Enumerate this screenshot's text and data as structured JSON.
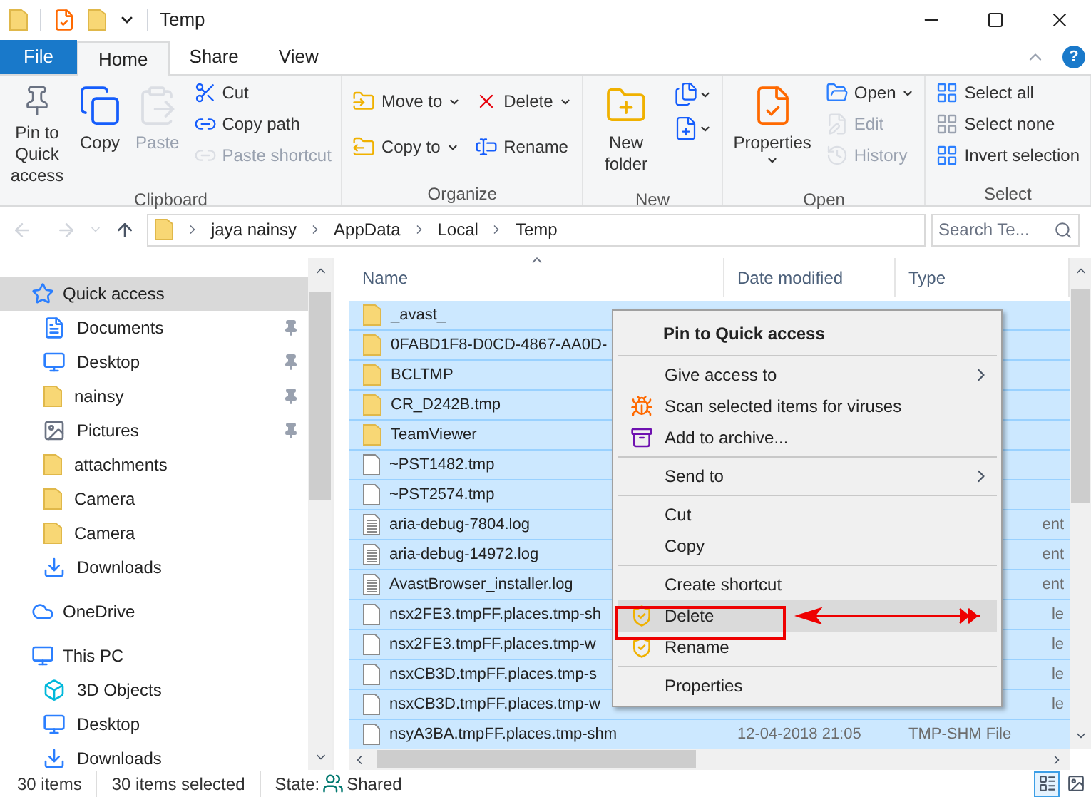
{
  "window": {
    "title": "Temp",
    "help": "?"
  },
  "ribbon_tabs": [
    {
      "label": "File",
      "kind": "file",
      "selected": false
    },
    {
      "label": "Home",
      "kind": "tab",
      "selected": true
    },
    {
      "label": "Share",
      "kind": "tab",
      "selected": false
    },
    {
      "label": "View",
      "kind": "tab",
      "selected": false
    }
  ],
  "ribbon_groups": [
    {
      "label": "Clipboard",
      "columns": [
        [
          {
            "label": "Pin to Quick access",
            "kind": "large",
            "disabled": false,
            "dropdown": false
          }
        ],
        [
          {
            "label": "Copy",
            "kind": "large",
            "disabled": false,
            "dropdown": false
          }
        ],
        [
          {
            "label": "Paste",
            "kind": "large",
            "disabled": true,
            "dropdown": false
          }
        ],
        [
          {
            "label": "Cut",
            "kind": "small",
            "disabled": false,
            "dropdown": false
          },
          {
            "label": "Copy path",
            "kind": "small",
            "disabled": false,
            "dropdown": false
          },
          {
            "label": "Paste shortcut",
            "kind": "small",
            "disabled": true,
            "dropdown": false
          }
        ]
      ]
    },
    {
      "label": "Organize",
      "columns": [
        [
          {
            "label": "Move to",
            "kind": "small",
            "disabled": false,
            "dropdown": true
          },
          {
            "label": "Copy to",
            "kind": "small",
            "disabled": false,
            "dropdown": true
          }
        ],
        [
          {
            "label": "Delete",
            "kind": "small",
            "disabled": false,
            "dropdown": true
          },
          {
            "label": "Rename",
            "kind": "small",
            "disabled": false,
            "dropdown": false
          }
        ]
      ]
    },
    {
      "label": "New",
      "columns": [
        [
          {
            "label": "New folder",
            "kind": "large",
            "disabled": false,
            "dropdown": false
          }
        ],
        [
          {
            "kind": "icon",
            "disabled": false,
            "dropdown": true
          },
          {
            "kind": "icon",
            "disabled": false,
            "dropdown": true
          }
        ]
      ]
    },
    {
      "label": "Open",
      "columns": [
        [
          {
            "label": "Properties",
            "kind": "large",
            "disabled": false,
            "dropdown": true
          }
        ],
        [
          {
            "label": "Open",
            "kind": "small",
            "disabled": false,
            "dropdown": true
          },
          {
            "label": "Edit",
            "kind": "small",
            "disabled": true,
            "dropdown": false
          },
          {
            "label": "History",
            "kind": "small",
            "disabled": true,
            "dropdown": false
          }
        ]
      ]
    },
    {
      "label": "Select",
      "columns": [
        [
          {
            "label": "Select all",
            "kind": "small",
            "disabled": false,
            "dropdown": false
          },
          {
            "label": "Select none",
            "kind": "small",
            "disabled": false,
            "dropdown": false
          },
          {
            "label": "Invert selection",
            "kind": "small",
            "disabled": false,
            "dropdown": false
          }
        ]
      ]
    }
  ],
  "address_bar": {
    "path": [
      "jaya nainsy",
      "AppData",
      "Local",
      "Temp"
    ]
  },
  "search": {
    "placeholder": "Search Te..."
  },
  "navigation_pane": [
    {
      "label": "Quick access",
      "selected": true,
      "children": [
        {
          "label": "Documents",
          "pinned": true
        },
        {
          "label": "Desktop",
          "pinned": true
        },
        {
          "label": "nainsy",
          "pinned": true
        },
        {
          "label": "Pictures",
          "pinned": true
        },
        {
          "label": "attachments",
          "pinned": false
        },
        {
          "label": "Camera",
          "pinned": false
        },
        {
          "label": "Camera",
          "pinned": false
        },
        {
          "label": "Downloads",
          "pinned": false
        }
      ]
    },
    {
      "label": "OneDrive",
      "selected": false
    },
    {
      "label": "This PC",
      "selected": false,
      "children": [
        {
          "label": "3D Objects",
          "pinned": false
        },
        {
          "label": "Desktop",
          "pinned": false
        },
        {
          "label": "Downloads",
          "pinned": false
        }
      ]
    }
  ],
  "columns": [
    {
      "label": "Name",
      "sorted": true
    },
    {
      "label": "Date modified",
      "sorted": false
    },
    {
      "label": "Type",
      "sorted": false
    }
  ],
  "rows": [
    {
      "name": "_avast_",
      "kind": "folder",
      "selected": true
    },
    {
      "name": "0FABD1F8-D0CD-4867-AA0D-",
      "kind": "folder",
      "selected": true
    },
    {
      "name": "BCLTMP",
      "kind": "folder",
      "selected": true
    },
    {
      "name": "CR_D242B.tmp",
      "kind": "folder",
      "selected": true
    },
    {
      "name": "TeamViewer",
      "kind": "folder",
      "selected": true
    },
    {
      "name": "~PST1482.tmp",
      "kind": "file",
      "selected": true
    },
    {
      "name": "~PST2574.tmp",
      "kind": "file",
      "selected": true
    },
    {
      "name": "aria-debug-7804.log",
      "kind": "text",
      "type": "ent",
      "selected": true
    },
    {
      "name": "aria-debug-14972.log",
      "kind": "text",
      "type": "ent",
      "selected": true
    },
    {
      "name": "AvastBrowser_installer.log",
      "kind": "text",
      "type": "ent",
      "selected": true
    },
    {
      "name": "nsx2FE3.tmpFF.places.tmp-sh",
      "kind": "file",
      "type": "le",
      "selected": true
    },
    {
      "name": "nsx2FE3.tmpFF.places.tmp-w",
      "kind": "file",
      "type": "le",
      "selected": true
    },
    {
      "name": "nsxCB3D.tmpFF.places.tmp-s",
      "kind": "file",
      "type": "le",
      "selected": true
    },
    {
      "name": "nsxCB3D.tmpFF.places.tmp-w",
      "kind": "file",
      "type": "le",
      "selected": true
    },
    {
      "name": "nsyA3BA.tmpFF.places.tmp-shm",
      "kind": "file",
      "date": "12-04-2018 21:05",
      "type": "TMP-SHM File",
      "selected": true
    }
  ],
  "context_menu": {
    "groups": [
      [
        {
          "label": "Pin to Quick access",
          "default": true,
          "submenu": false,
          "selected": false
        }
      ],
      [
        {
          "label": "Give access to",
          "default": false,
          "submenu": true,
          "selected": false
        },
        {
          "label": "Scan selected items for viruses",
          "default": false,
          "submenu": false,
          "selected": false
        },
        {
          "label": "Add to archive...",
          "default": false,
          "submenu": false,
          "selected": false
        }
      ],
      [
        {
          "label": "Send to",
          "default": false,
          "submenu": true,
          "selected": false
        }
      ],
      [
        {
          "label": "Cut",
          "default": false,
          "submenu": false,
          "selected": false
        },
        {
          "label": "Copy",
          "default": false,
          "submenu": false,
          "selected": false
        }
      ],
      [
        {
          "label": "Create shortcut",
          "default": false,
          "submenu": false,
          "selected": false
        },
        {
          "label": "Delete",
          "default": false,
          "submenu": false,
          "selected": true
        },
        {
          "label": "Rename",
          "default": false,
          "submenu": false,
          "selected": false
        }
      ],
      [
        {
          "label": "Properties",
          "default": false,
          "submenu": false,
          "selected": false
        }
      ]
    ]
  },
  "status_bar": {
    "items": "30 items",
    "selected": "30 items selected",
    "state_label": "State:",
    "state": "Shared"
  },
  "view_buttons": [
    {
      "kind": "details",
      "selected": true
    },
    {
      "kind": "large_icons",
      "selected": false
    }
  ]
}
